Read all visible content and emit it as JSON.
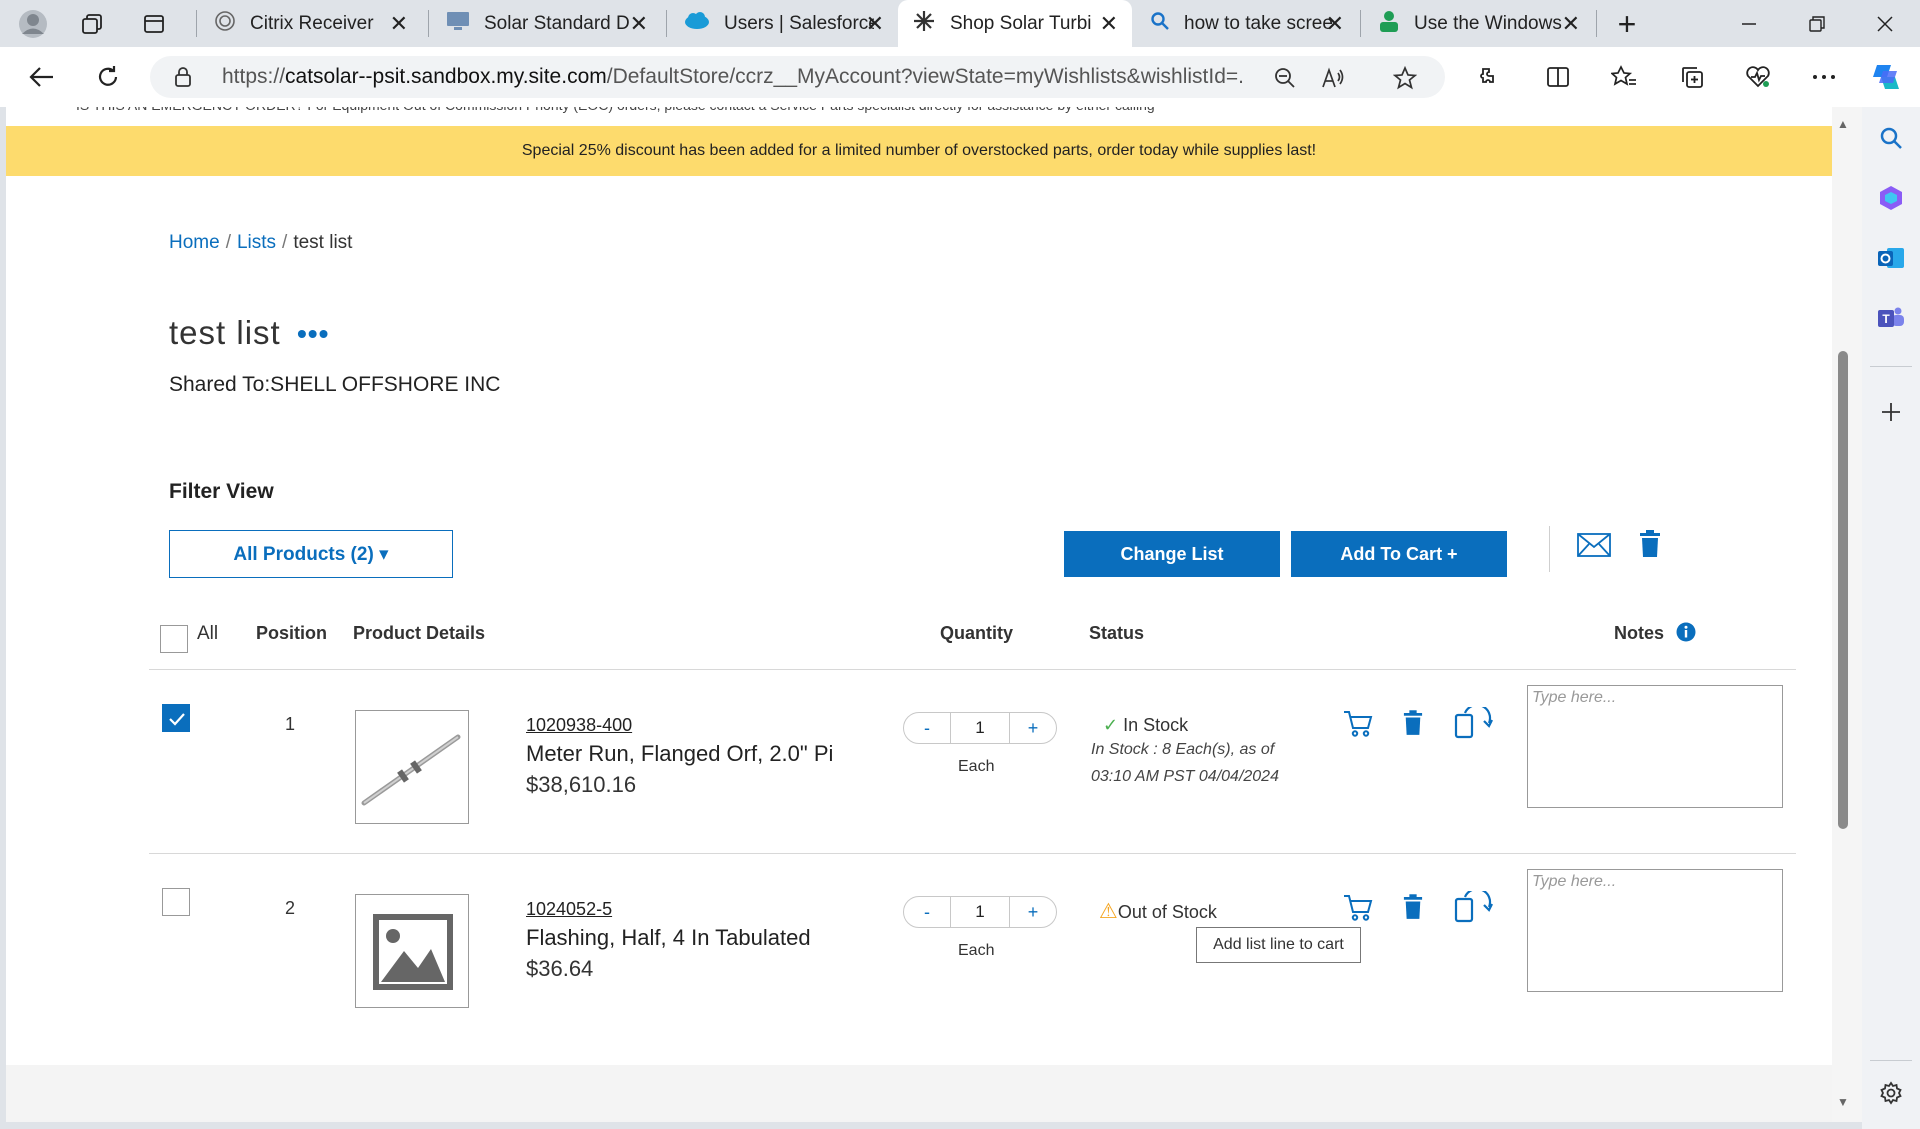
{
  "browser": {
    "tabs": [
      {
        "title": "Citrix Receiver",
        "icon": "citrix-icon",
        "close": "✕"
      },
      {
        "title": "Solar Standard D",
        "icon": "monitor-icon",
        "close": "✕"
      },
      {
        "title": "Users | Salesforce",
        "icon": "salesforce-cloud-icon",
        "close": "✕"
      },
      {
        "title": "Shop Solar Turbi",
        "icon": "turbine-icon",
        "close": "✕"
      },
      {
        "title": "how to take scree",
        "icon": "search-icon",
        "close": "✕"
      },
      {
        "title": "Use the Windows",
        "icon": "person-icon",
        "close": "✕"
      }
    ],
    "new_tab": "+",
    "url_prefix": "https://",
    "url_host": "catsolar--psit.sandbox.my.site.com",
    "url_path": "/DefaultStore/ccrz__MyAccount?viewState=myWishlists&wishlistId=..."
  },
  "page": {
    "notice_cut": "IS THIS AN EMERGENCY ORDER? For Equipment Out of Commission Priority (EOC) orders, please contact a Service Parts specialist directly for assistance by either calling",
    "promo_banner": "Special 25% discount has been added for a limited number of overstocked parts, order today while supplies last!",
    "breadcrumb": {
      "home": "Home",
      "lists": "Lists",
      "current": "test list",
      "sep": "/"
    },
    "list_title": "test list",
    "list_more": "•••",
    "shared_to": "Shared To:SHELL OFFSHORE INC",
    "filter_label": "Filter View",
    "filter_dropdown": "All Products (2) ▾",
    "change_list_button": "Change List",
    "add_to_cart_button": "Add To Cart +",
    "columns": {
      "all": "All",
      "position": "Position",
      "product_details": "Product Details",
      "quantity": "Quantity",
      "status": "Status",
      "notes": "Notes"
    },
    "rows": [
      {
        "checked": true,
        "position": "1",
        "sku": "1020938-400",
        "name": "Meter Run, Flanged Orf, 2.0\" Pi",
        "price": "$38,610.16",
        "qty": "1",
        "minus": "-",
        "plus": "+",
        "unit": "Each",
        "status_mark": "✓",
        "status": "In Stock",
        "status_detail_1": "In Stock : 8 Each(s), as of",
        "status_detail_2": "03:10 AM PST 04/04/2024",
        "notes_placeholder": "Type here..."
      },
      {
        "checked": false,
        "position": "2",
        "sku": "1024052-5",
        "name": "Flashing, Half, 4 In Tabulated",
        "price": "$36.64",
        "qty": "1",
        "minus": "-",
        "plus": "+",
        "unit": "Each",
        "status_mark": "⚠",
        "status": "Out of Stock",
        "notes_placeholder": "Type here..."
      }
    ],
    "tooltip": "Add list line to cart",
    "colors": {
      "brand_blue": "#0a6ebd",
      "promo_yellow": "#fddb6d",
      "in_stock_green": "#4caf50",
      "warning_orange": "#f5a623"
    }
  }
}
